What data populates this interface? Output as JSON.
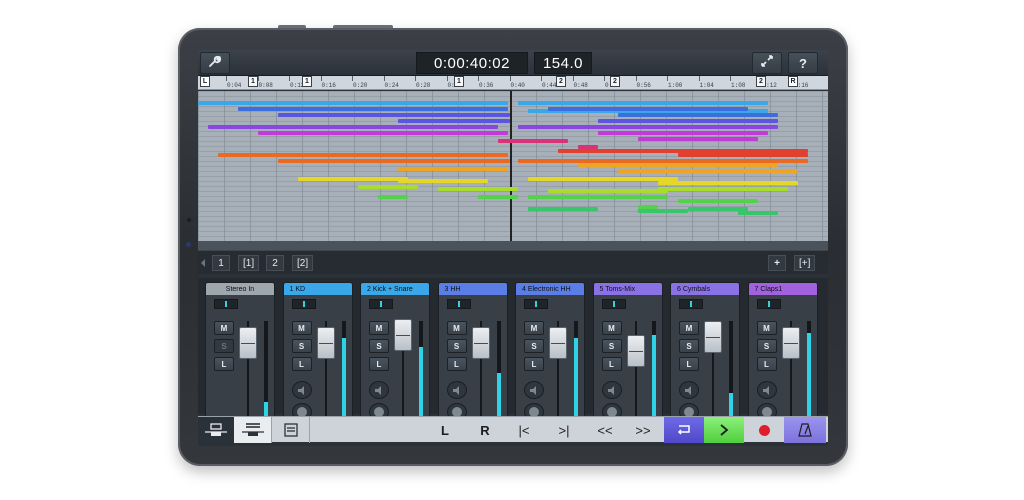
{
  "toolbar": {
    "settings_icon": "wrench-icon",
    "time_display": "0:00:40:02",
    "tempo_display": "154.0",
    "zoom_icon": "fit-arrows-icon",
    "help_label": "?"
  },
  "ruler": {
    "ticks": [
      "0:04",
      "0:08",
      "0:12",
      "0:16",
      "0:20",
      "0:24",
      "0:28",
      "0:32",
      "0:36",
      "0:40",
      "0:44",
      "0:48",
      "0:52",
      "0:56",
      "1:00",
      "1:04",
      "1:08",
      "1:12",
      "1:16"
    ],
    "markers": [
      "L",
      "1",
      "1",
      "1",
      "2",
      "2",
      "2",
      "R"
    ]
  },
  "arrange": {
    "colors": [
      "#3aa7e8",
      "#3d6ee0",
      "#5b55e0",
      "#8a47e0",
      "#c33ad8",
      "#d8327a",
      "#e0402e",
      "#e86a23",
      "#eea525",
      "#e4d72a",
      "#a8dd2c",
      "#55d24b",
      "#39c66a"
    ]
  },
  "scenes": {
    "items": [
      "1",
      "[1]",
      "2",
      "[2]"
    ],
    "add_label": "+",
    "add_bracket_label": "[+]"
  },
  "mixer": {
    "channels": [
      {
        "name": "Stereo In",
        "color": "#9ea6ae",
        "level": 0.3
      },
      {
        "name": "1  KD",
        "color": "#3aa7e8",
        "level": 0.85
      },
      {
        "name": "2  Kick + Snare",
        "color": "#3aa7e8",
        "level": 0.78
      },
      {
        "name": "3  HH",
        "color": "#5b7ee6",
        "level": 0.55
      },
      {
        "name": "4  Electronic HH",
        "color": "#5b7ee6",
        "level": 0.85
      },
      {
        "name": "5  Toms-Mix",
        "color": "#8a72e6",
        "level": 0.88
      },
      {
        "name": "6  Cymbals",
        "color": "#8a72e6",
        "level": 0.38
      },
      {
        "name": "7  Claps1",
        "color": "#a262e0",
        "level": 0.9
      }
    ],
    "mute_label": "M",
    "solo_label": "S",
    "listen_label": "L"
  },
  "transport": {
    "left_locator": "L",
    "right_locator": "R",
    "prev_marker": "|<",
    "next_marker": ">|",
    "rewind": "<<",
    "forward": ">>"
  }
}
